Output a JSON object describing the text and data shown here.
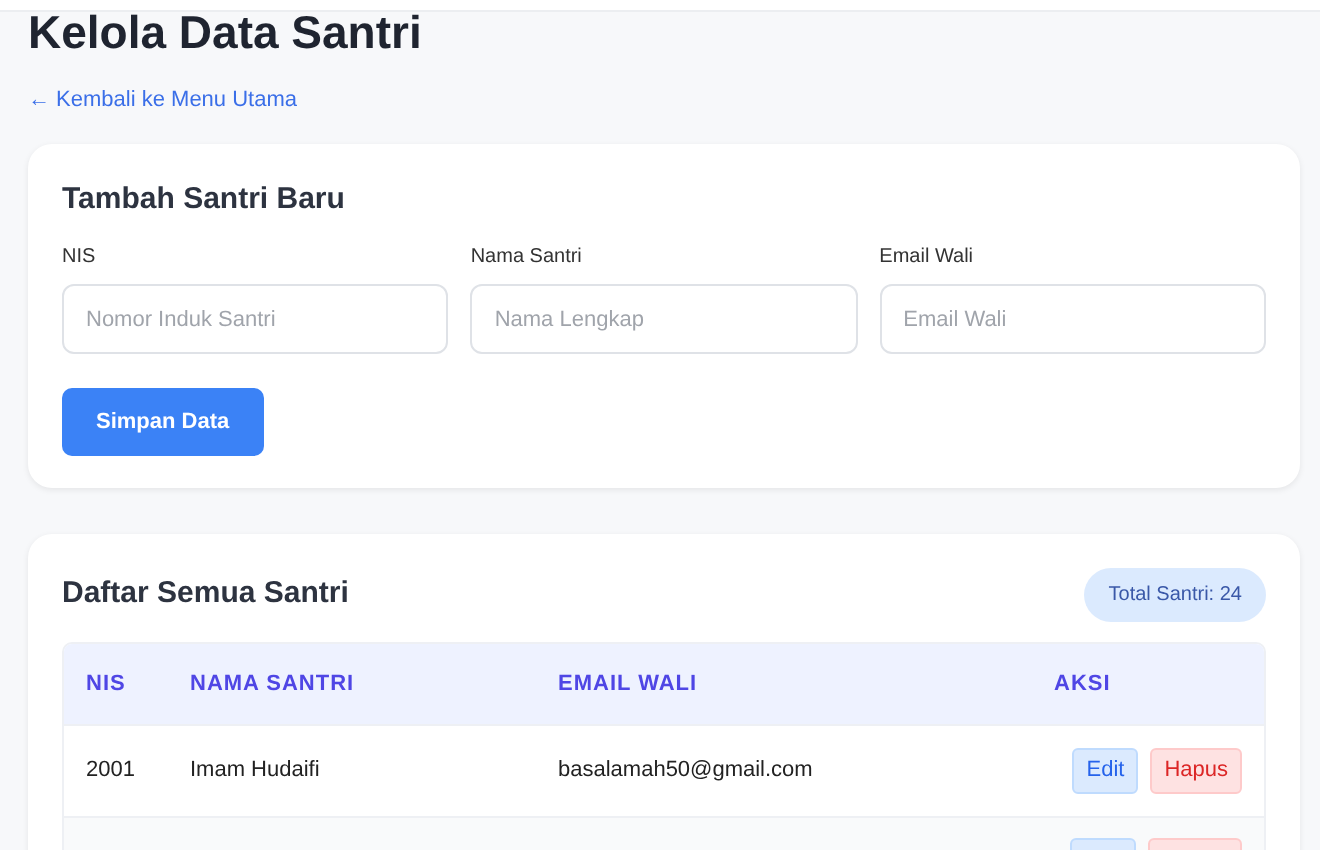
{
  "title": "Kelola Data Santri",
  "back_link": "← Kembali ke Menu Utama",
  "form": {
    "title": "Tambah Santri Baru",
    "fields": [
      {
        "label": "NIS",
        "placeholder": "Nomor Induk Santri"
      },
      {
        "label": "Nama Santri",
        "placeholder": "Nama Lengkap"
      },
      {
        "label": "Email Wali",
        "placeholder": "Email Wali"
      }
    ],
    "submit": "Simpan Data"
  },
  "list": {
    "title": "Daftar Semua Santri",
    "badge": "Total Santri: 24",
    "table": {
      "columns": [
        "NIS",
        "NAMA SANTRI",
        "EMAIL WALI",
        "AKSI"
      ],
      "rows": [
        {
          "nis": "2001",
          "name": "Imam Hudaifi",
          "email": "basalamah50@gmail.com",
          "actions": [
            "Edit",
            "Hapus"
          ]
        },
        {
          "kind": "cut"
        }
      ]
    }
  }
}
